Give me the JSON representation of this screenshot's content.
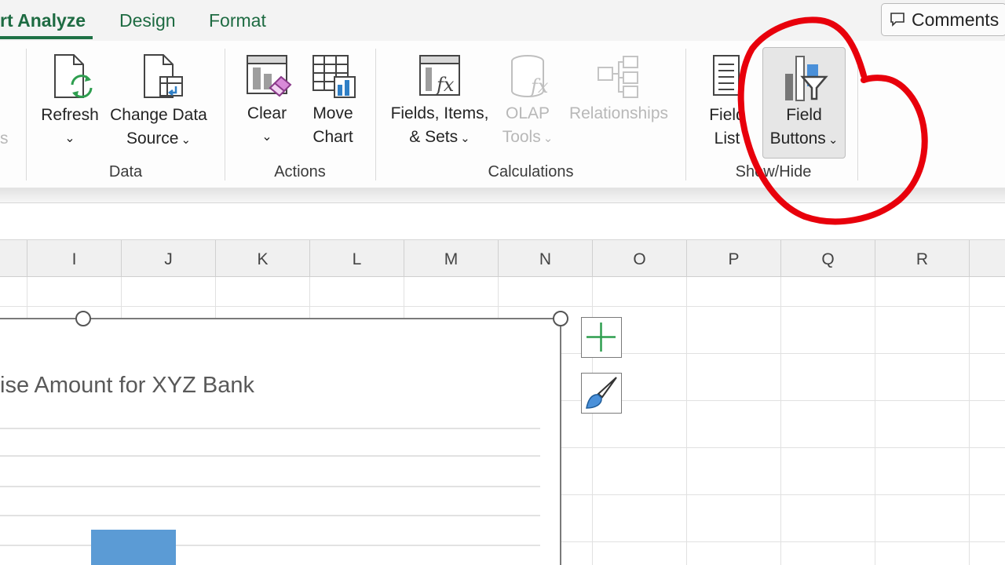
{
  "tabs": [
    {
      "label": "rt Analyze",
      "active": true
    },
    {
      "label": "Design",
      "active": false
    },
    {
      "label": "Format",
      "active": false
    }
  ],
  "comments": {
    "label": "Comments"
  },
  "ribbon": {
    "cut_label": "s",
    "refresh": {
      "l1": "Refresh",
      "chev": "⌄"
    },
    "change_data_source": {
      "l1": "Change Data",
      "l2": "Source",
      "chev": "⌄"
    },
    "clear": {
      "l1": "Clear",
      "chev": "⌄"
    },
    "move_chart": {
      "l1": "Move",
      "l2": "Chart"
    },
    "fields_items_sets": {
      "l1": "Fields, Items,",
      "l2": "& Sets",
      "chev": "⌄"
    },
    "olap_tools": {
      "l1": "OLAP",
      "l2": "Tools",
      "chev": "⌄"
    },
    "relationships": {
      "l1": "Relationships"
    },
    "field_list": {
      "l1": "Field",
      "l2": "List"
    },
    "field_buttons": {
      "l1": "Field",
      "l2": "Buttons",
      "chev": "⌄"
    },
    "groups": {
      "data": "Data",
      "actions": "Actions",
      "calculations": "Calculations",
      "show_hide": "Show/Hide"
    }
  },
  "columns": [
    "I",
    "J",
    "K",
    "L",
    "M",
    "N",
    "O",
    "P",
    "Q",
    "R"
  ],
  "chart": {
    "title": "ise Amount for XYZ Bank"
  },
  "colors": {
    "accent_green": "#1e6b42",
    "bar_blue": "#5b9bd5",
    "annotation_red": "#e8000b"
  }
}
